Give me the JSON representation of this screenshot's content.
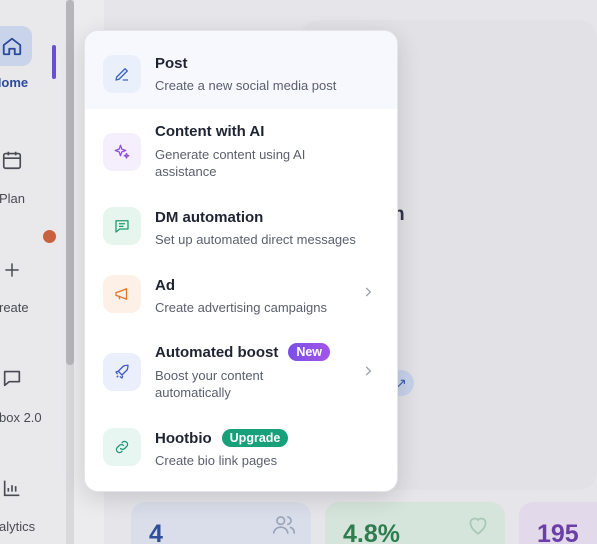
{
  "sidebar": {
    "items": [
      {
        "label": "Home",
        "icon": "home-icon"
      },
      {
        "label": "Plan",
        "icon": "calendar-icon"
      },
      {
        "label": "reate",
        "icon": "plus-icon"
      },
      {
        "label": "box 2.0",
        "icon": "chat-icon"
      },
      {
        "label": "alytics",
        "icon": "bar-chart-icon"
      }
    ]
  },
  "background": {
    "partial_heading": "h",
    "stats": [
      {
        "value": "4",
        "icon": "users-icon"
      },
      {
        "value": "4.8%",
        "icon": "heart-icon"
      },
      {
        "value": "195",
        "icon": ""
      }
    ]
  },
  "menu": {
    "items": [
      {
        "title": "Post",
        "desc": "Create a new social media post",
        "icon": "pencil-icon"
      },
      {
        "title": "Content with AI",
        "desc": "Generate content using AI assistance",
        "icon": "sparkles-icon"
      },
      {
        "title": "DM automation",
        "desc": "Set up automated direct messages",
        "icon": "message-icon"
      },
      {
        "title": "Ad",
        "desc": "Create advertising campaigns",
        "icon": "megaphone-icon"
      },
      {
        "title": "Automated boost",
        "desc": "Boost your content automatically",
        "badge": "New",
        "icon": "rocket-icon"
      },
      {
        "title": "Hootbio",
        "desc": "Create bio link pages",
        "badge": "Upgrade",
        "icon": "link-icon"
      }
    ]
  },
  "colors": {
    "accent": "#6b4fd1",
    "new_badge": "#7b4fe6",
    "upgrade_badge": "#17a07a"
  }
}
